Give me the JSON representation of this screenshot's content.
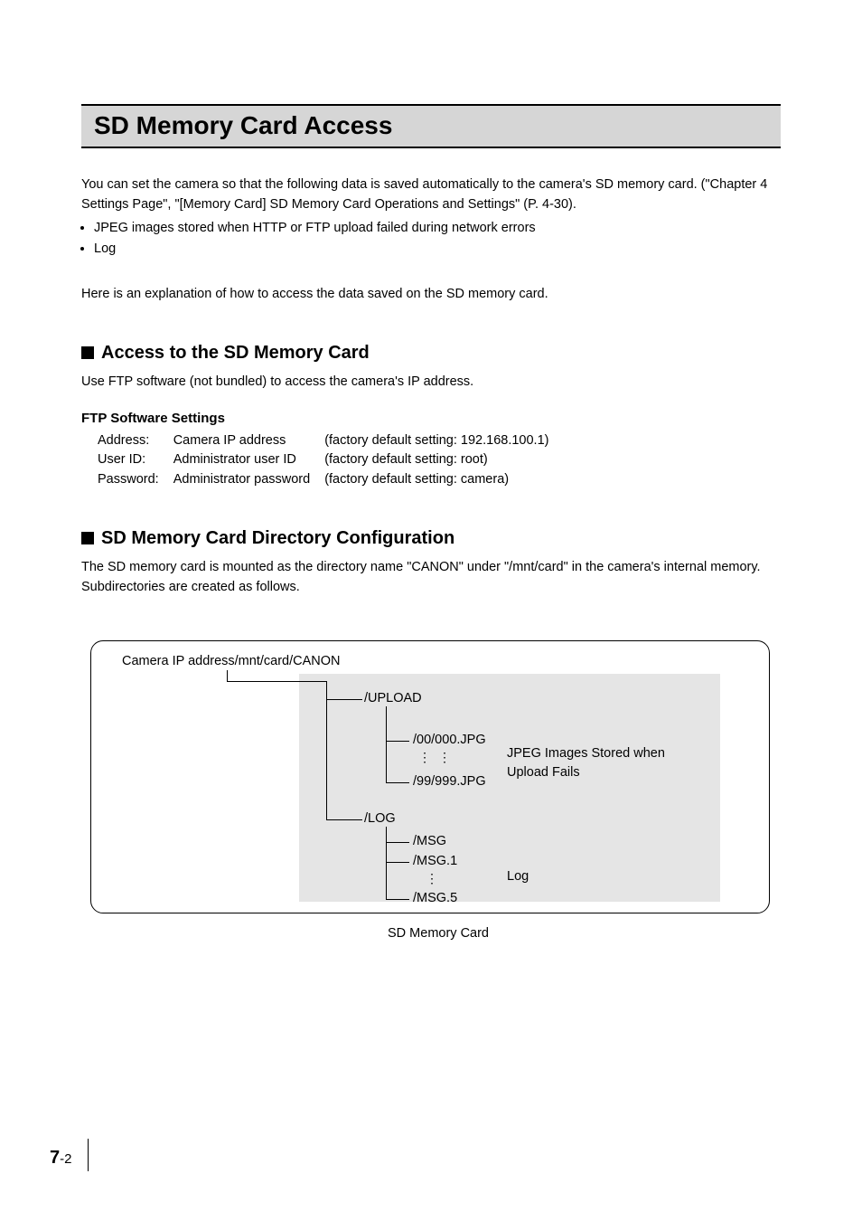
{
  "title": "SD Memory Card Access",
  "intro_paragraph": "You can set the camera so that the following data is saved automatically to the camera's SD memory card. (\"Chapter 4 Settings Page\", \"[Memory Card] SD Memory Card Operations and Settings\" (P. 4-30).",
  "intro_bullets": [
    "JPEG images stored when HTTP or FTP upload failed during network errors",
    "Log"
  ],
  "intro_followup": "Here is an explanation of how to access the data saved on the SD memory card.",
  "section_access": {
    "heading": "Access to the SD Memory Card",
    "text": "Use FTP software (not bundled) to access the camera's IP address.",
    "subheading": "FTP Software Settings",
    "rows": [
      {
        "label": "Address:",
        "value": "Camera IP address",
        "note": "(factory default setting: 192.168.100.1)"
      },
      {
        "label": "User ID:",
        "value": "Administrator user ID",
        "note": "(factory default setting: root)"
      },
      {
        "label": "Password:",
        "value": "Administrator password",
        "note": "(factory default setting: camera)"
      }
    ]
  },
  "section_directory": {
    "heading": "SD Memory Card Directory Configuration",
    "text": "The SD memory card is mounted as the directory name \"CANON\" under \"/mnt/card\" in the camera's internal memory. Subdirectories are created as follows."
  },
  "diagram": {
    "root": "Camera IP address/mnt/card/CANON",
    "upload_dir": "/UPLOAD",
    "upload_first": "/00/000.JPG",
    "upload_last": "/99/999.JPG",
    "upload_desc": "JPEG Images Stored when Upload Fails",
    "log_dir": "/LOG",
    "log_first": "/MSG",
    "log_second": "/MSG.1",
    "log_last": "/MSG.5",
    "log_desc": "Log",
    "caption": "SD Memory Card"
  },
  "page_number": {
    "chapter": "7",
    "page": "-2"
  }
}
